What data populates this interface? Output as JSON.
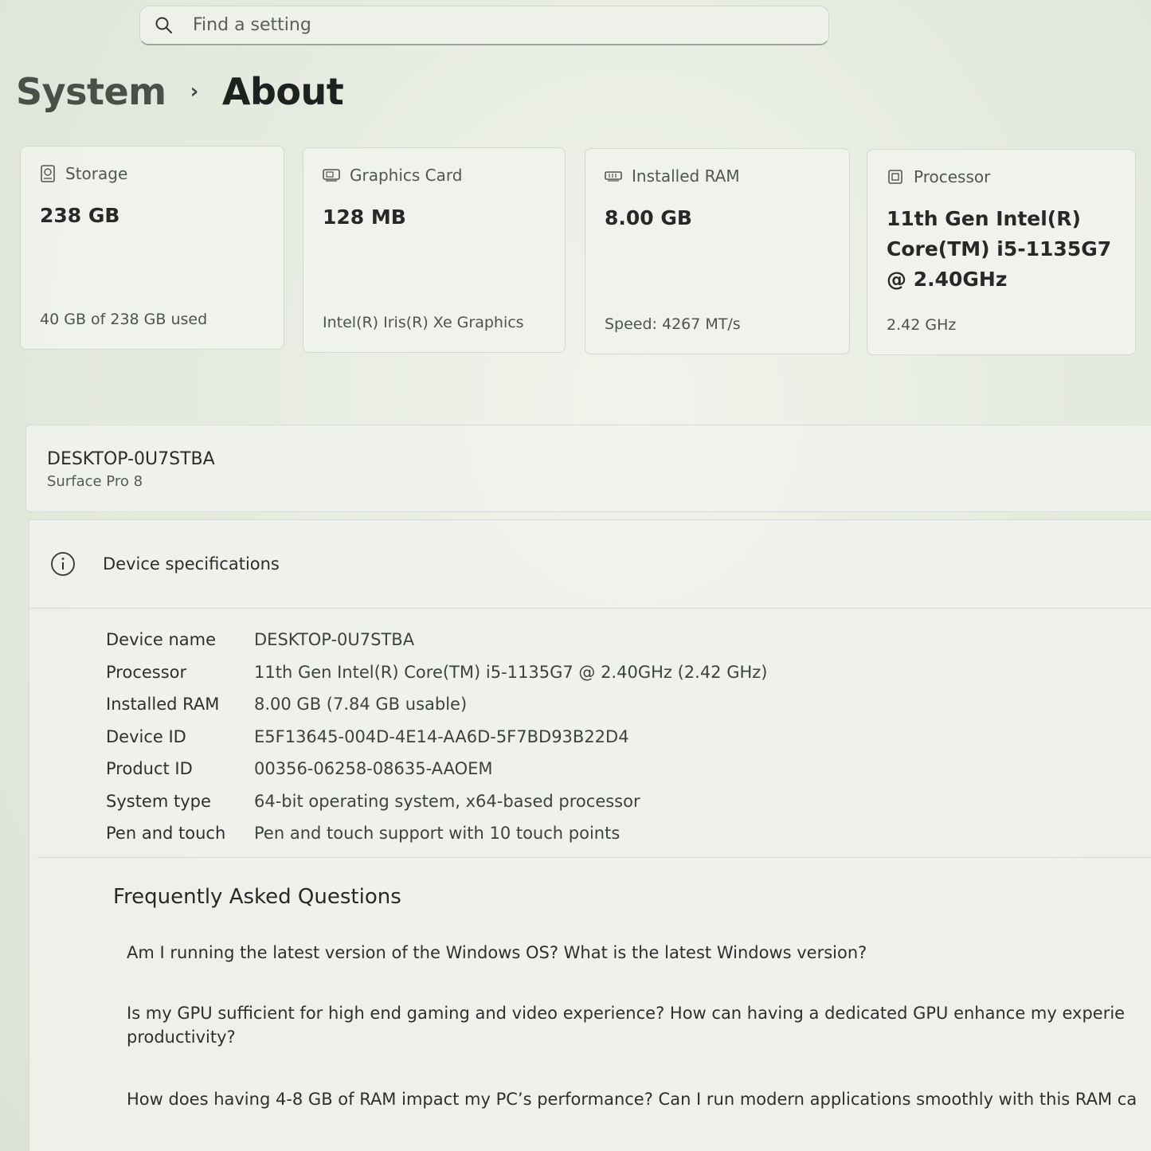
{
  "search": {
    "placeholder": "Find a setting"
  },
  "breadcrumb": {
    "parent": "System",
    "separator": "›",
    "current": "About"
  },
  "cards": {
    "storage": {
      "label": "Storage",
      "value": "238 GB",
      "sub": "40 GB of 238 GB used",
      "icon": "storage-icon"
    },
    "graphics": {
      "label": "Graphics Card",
      "value": "128 MB",
      "sub": "Intel(R) Iris(R) Xe Graphics",
      "icon": "display-adapter-icon"
    },
    "ram": {
      "label": "Installed RAM",
      "value": "8.00 GB",
      "sub": "Speed: 4267 MT/s",
      "icon": "memory-icon"
    },
    "processor": {
      "label": "Processor",
      "value": "11th Gen Intel(R) Core(TM) i5-1135G7 @ 2.40GHz",
      "sub": "2.42 GHz",
      "icon": "chip-icon"
    }
  },
  "device": {
    "name": "DESKTOP-0U7STBA",
    "model": "Surface Pro 8"
  },
  "specs": {
    "title": "Device specifications",
    "rows": [
      {
        "label": "Device name",
        "value": "DESKTOP-0U7STBA"
      },
      {
        "label": "Processor",
        "value": "11th Gen Intel(R) Core(TM) i5-1135G7 @ 2.40GHz (2.42 GHz)"
      },
      {
        "label": "Installed RAM",
        "value": "8.00 GB (7.84 GB usable)"
      },
      {
        "label": "Device ID",
        "value": "E5F13645-004D-4E14-AA6D-5F7BD93B22D4"
      },
      {
        "label": "Product ID",
        "value": "00356-06258-08635-AAOEM"
      },
      {
        "label": "System type",
        "value": "64-bit operating system, x64-based processor"
      },
      {
        "label": "Pen and touch",
        "value": "Pen and touch support with 10 touch points"
      }
    ]
  },
  "faq": {
    "title": "Frequently Asked Questions",
    "items": [
      "Am I running the latest version of the Windows OS? What is the latest Windows version?",
      "Is my GPU sufficient for high end gaming and video experience? How can having a dedicated GPU enhance my experie productivity?",
      "How does having 4-8 GB of RAM impact my PC’s performance? Can I run modern applications smoothly with this RAM ca"
    ]
  }
}
